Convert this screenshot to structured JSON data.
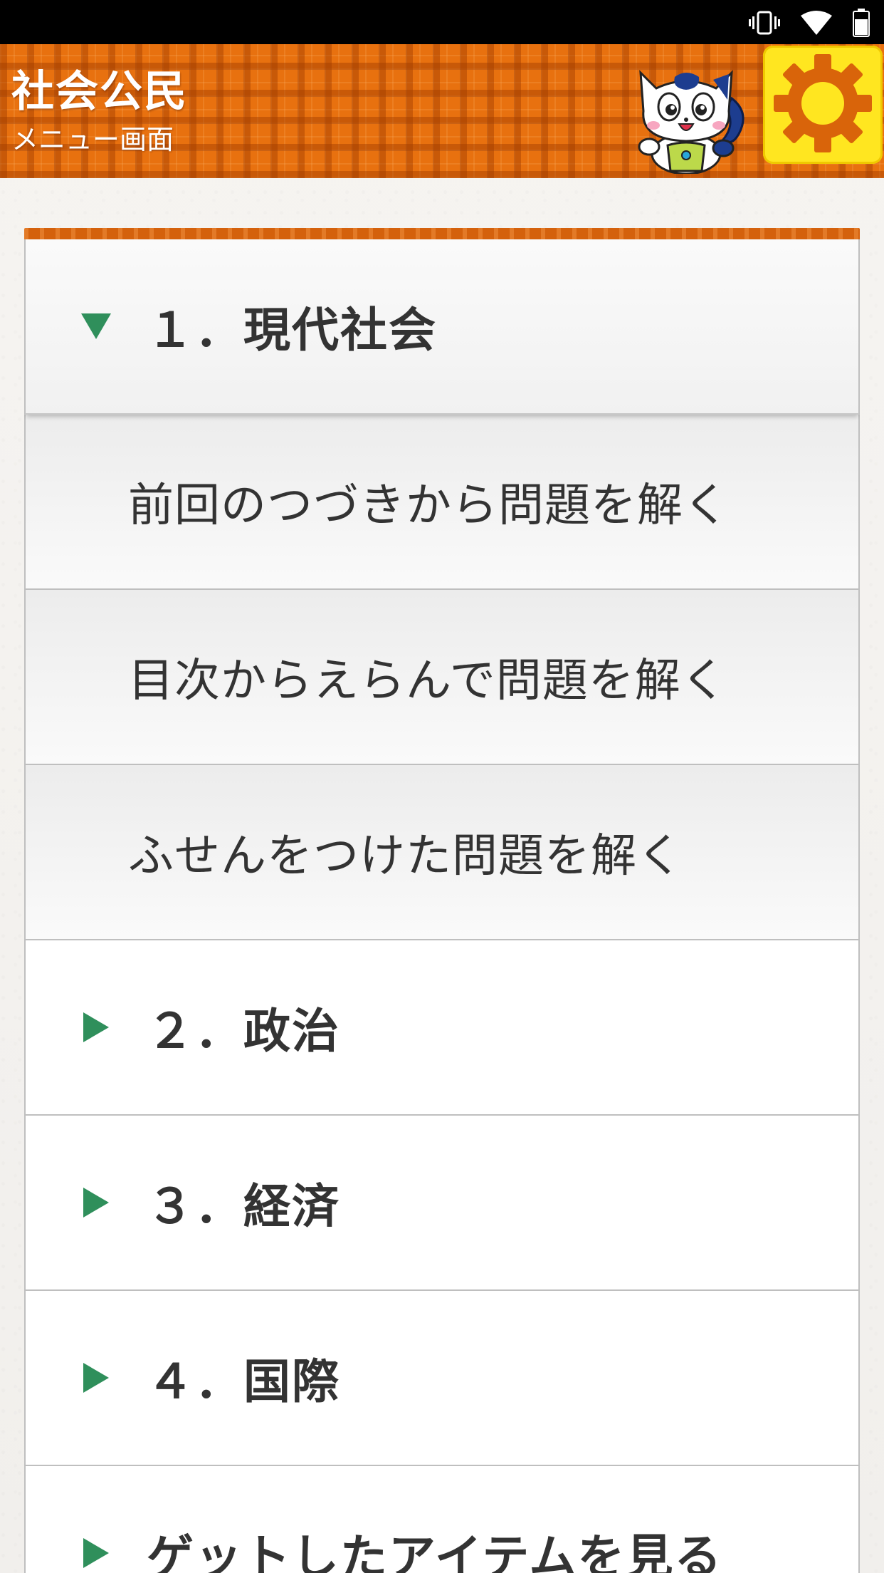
{
  "status_bar": {
    "icons": [
      "vibrate-icon",
      "wifi-icon",
      "battery-icon"
    ]
  },
  "header": {
    "title": "社会公民",
    "subtitle": "メニュー画面",
    "mascot": "cat-mascot-icon",
    "settings_icon": "gear-icon"
  },
  "menu": {
    "sections": [
      {
        "label": "１．現代社会",
        "expanded": true,
        "items": [
          {
            "label": "前回のつづきから問題を解く"
          },
          {
            "label": "目次からえらんで問題を解く"
          },
          {
            "label": "ふせんをつけた問題を解く"
          }
        ]
      },
      {
        "label": "２．政治",
        "expanded": false
      },
      {
        "label": "３．経済",
        "expanded": false
      },
      {
        "label": "４．国際",
        "expanded": false
      },
      {
        "label": "ゲットしたアイテムを見る",
        "expanded": false
      }
    ]
  },
  "colors": {
    "header_orange": "#e8710f",
    "settings_yellow": "#ffe620",
    "gear_orange": "#d9640a",
    "arrow_green": "#2f8f5b",
    "text_dark": "#333333"
  }
}
